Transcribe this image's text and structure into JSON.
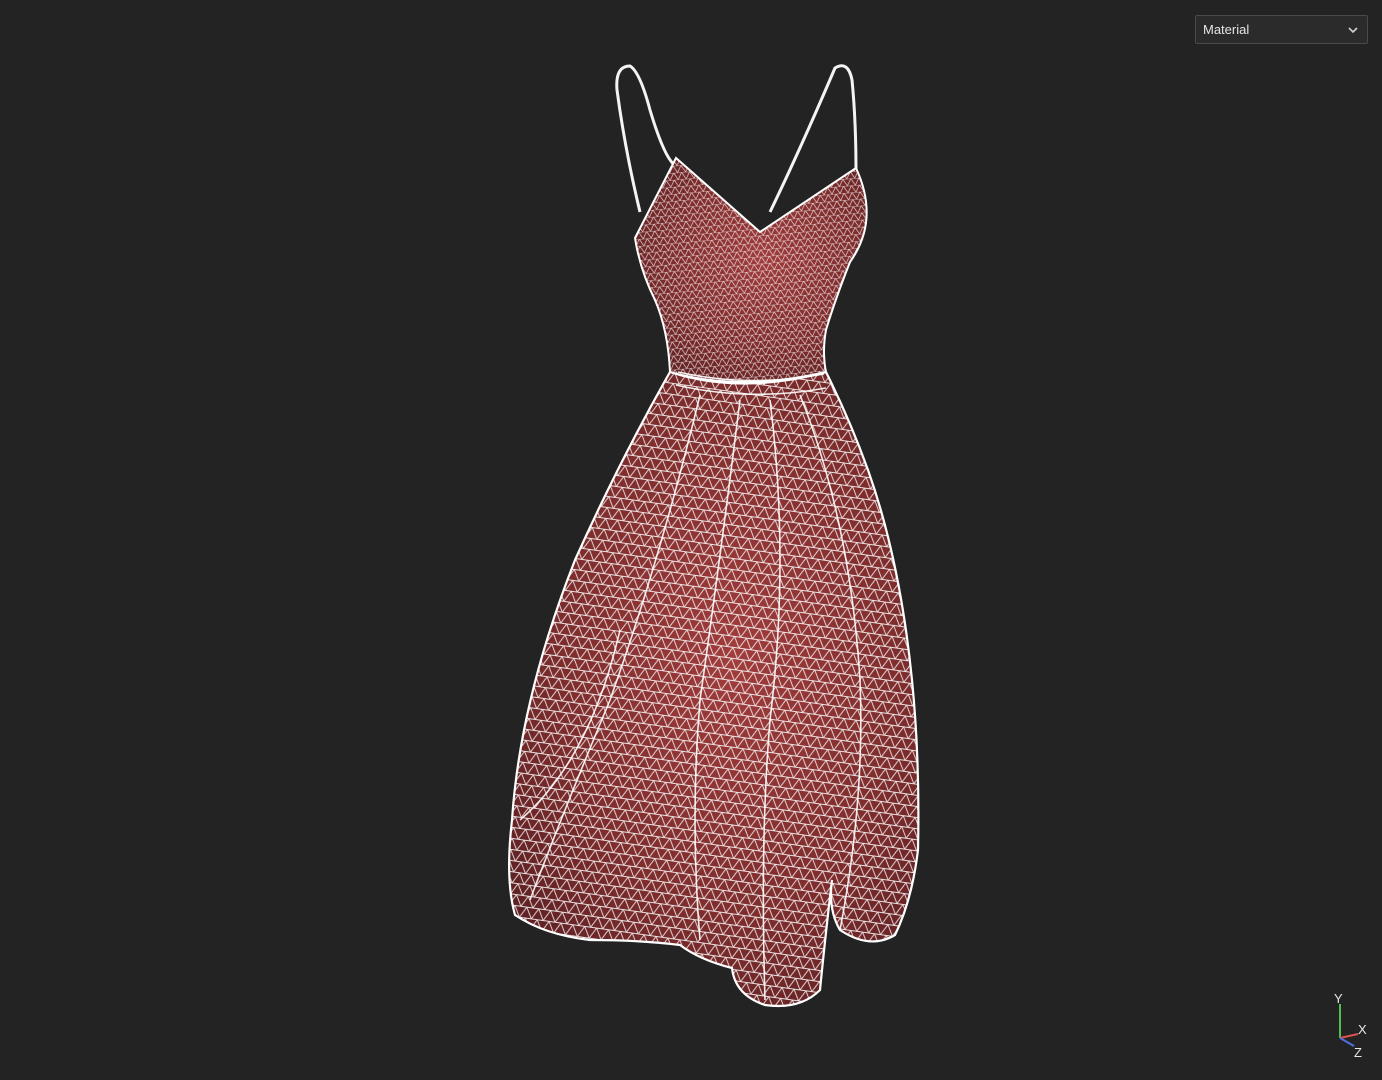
{
  "viewport": {
    "background": "#232323",
    "model": {
      "object": "dress",
      "display_mode": "wireframe-on-shaded",
      "fill_color": "#7d2c2c",
      "wire_color": "#ffffff"
    }
  },
  "shading_dropdown": {
    "selected": "Material",
    "icon": "chevron-down-icon"
  },
  "axis_gizmo": {
    "x_label": "X",
    "y_label": "Y",
    "z_label": "Z",
    "x_color": "#e05050",
    "y_color": "#50c050",
    "z_color": "#5070e0"
  }
}
